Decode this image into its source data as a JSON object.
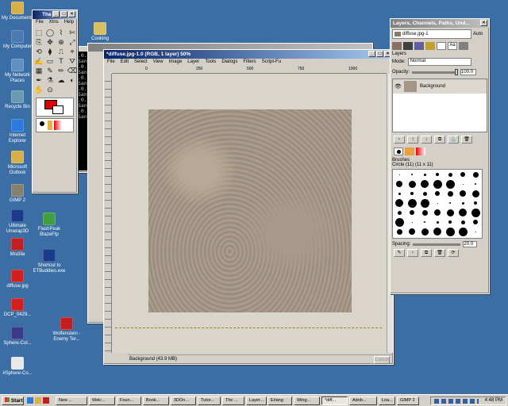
{
  "desktop": {
    "icons": [
      {
        "label": "My Documents",
        "color": "#d8b048"
      },
      {
        "label": "My Computer",
        "color": "#4a7ab0"
      },
      {
        "label": "My Network Places",
        "color": "#6090c0"
      },
      {
        "label": "Recycle Bin",
        "color": "#6a9ab0"
      },
      {
        "label": "Internet Explorer",
        "color": "#2a7ae0"
      },
      {
        "label": "Microsoft Outlook",
        "color": "#d8b048"
      },
      {
        "label": "GIMP 2",
        "color": "#888070"
      },
      {
        "label": "Ultimate Unwrap3D",
        "color": "#1a3a8a"
      },
      {
        "label": "Mozilla",
        "color": "#c02020"
      },
      {
        "label": "diffuse.jpg",
        "color": "#d02020"
      },
      {
        "label": "DCP_0429...",
        "color": "#d02020"
      },
      {
        "label": "Sphere-Col...",
        "color": "#3a3a8a"
      },
      {
        "label": "#Sphere-Co...",
        "color": "#e8e8e8"
      },
      {
        "label": "FlashPeak BlazeFtp",
        "color": "#40a040"
      },
      {
        "label": "Shortcut to ETBuddies.exe",
        "color": "#1a3a8a"
      },
      {
        "label": "Wolfenstein - Enemy Ter...",
        "color": "#c02020"
      },
      {
        "label": "Cooking",
        "color": "#d8c060"
      }
    ]
  },
  "toolbox": {
    "title": "The G",
    "menu": [
      "File",
      "Xtns",
      "Help"
    ]
  },
  "console": {
    "lines": [
      ".0.exe:2",
      "Sans Ita",
      ".0.exe:2",
      "Sans Ita",
      ".0.exe:2",
      "Sans Ita",
      ".0.exe:2",
      "Sans Ita",
      ".0.exe:2",
      "Sans Ita",
      ".0.exe:2",
      "Sans Ita"
    ]
  },
  "image_window": {
    "title": "*diffuse.jpg-1.0 (RGB, 1 layer) 50%",
    "menu": [
      "File",
      "Edit",
      "Select",
      "View",
      "Image",
      "Layer",
      "Tools",
      "Dialogs",
      "Filters",
      "Script-Fu"
    ],
    "ruler_labels": [
      "0",
      "250",
      "500",
      "750",
      "1000"
    ],
    "status": "Background (43.9 MB)",
    "cancel": "Cancel"
  },
  "layers_dock": {
    "title": "Layers, Channels, Paths, Und...",
    "image_select": "diffuse.jpg-1",
    "auto": "Auto",
    "section": "Layers",
    "mode_label": "Mode:",
    "mode_value": "Normal",
    "opacity_label": "Opacity:",
    "opacity_value": "100.0",
    "layer_name": "Background",
    "brushes_section": "Brushes",
    "brush_name": "Circle (11) (11 x 11)",
    "spacing_label": "Spacing:",
    "spacing_value": "20.0"
  },
  "taskbar": {
    "start": "Start",
    "buttons": [
      "New ...",
      "Welc...",
      "Foun...",
      "Book...",
      "3DOn...",
      "Tutor...",
      "The ...",
      "Layer...",
      "Erlang",
      "Wing...",
      "*diff...",
      "Adob...",
      "Loa...",
      "GIMP 2"
    ],
    "clock": "4:48 PM"
  }
}
